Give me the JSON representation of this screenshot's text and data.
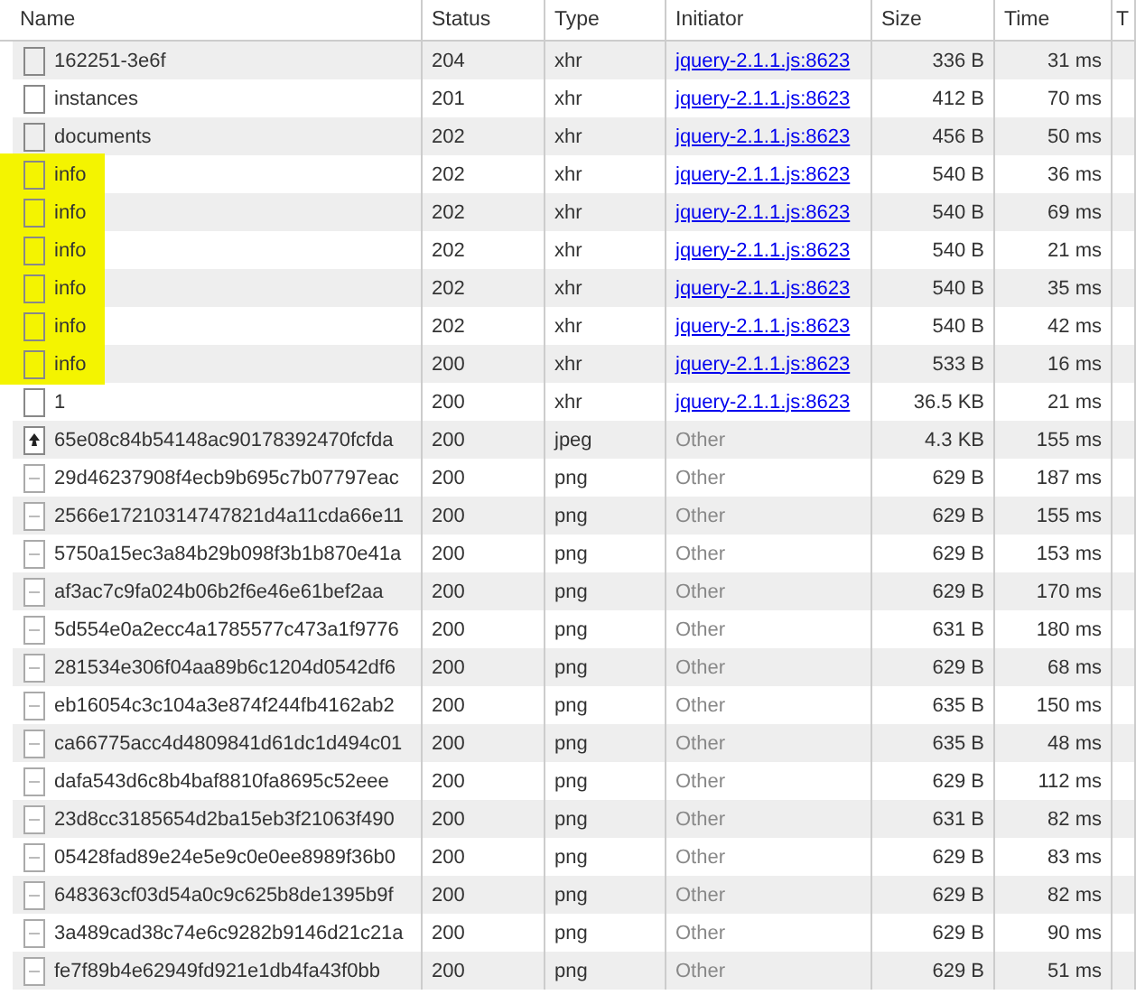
{
  "table": {
    "columns": [
      "Name",
      "Status",
      "Type",
      "Initiator",
      "Size",
      "Time",
      "T"
    ],
    "rows": [
      {
        "name": "162251-3e6f",
        "kind": "document",
        "status": "204",
        "type": "xhr",
        "initiator": {
          "kind": "link",
          "text": "jquery-2.1.1.js:8623"
        },
        "size": "336 B",
        "time": "31 ms",
        "highlighted": false
      },
      {
        "name": "instances",
        "kind": "document",
        "status": "201",
        "type": "xhr",
        "initiator": {
          "kind": "link",
          "text": "jquery-2.1.1.js:8623"
        },
        "size": "412 B",
        "time": "70 ms",
        "highlighted": false
      },
      {
        "name": "documents",
        "kind": "document",
        "status": "202",
        "type": "xhr",
        "initiator": {
          "kind": "link",
          "text": "jquery-2.1.1.js:8623"
        },
        "size": "456 B",
        "time": "50 ms",
        "highlighted": false
      },
      {
        "name": "info",
        "kind": "document",
        "status": "202",
        "type": "xhr",
        "initiator": {
          "kind": "link",
          "text": "jquery-2.1.1.js:8623"
        },
        "size": "540 B",
        "time": "36 ms",
        "highlighted": true
      },
      {
        "name": "info",
        "kind": "document",
        "status": "202",
        "type": "xhr",
        "initiator": {
          "kind": "link",
          "text": "jquery-2.1.1.js:8623"
        },
        "size": "540 B",
        "time": "69 ms",
        "highlighted": true
      },
      {
        "name": "info",
        "kind": "document",
        "status": "202",
        "type": "xhr",
        "initiator": {
          "kind": "link",
          "text": "jquery-2.1.1.js:8623"
        },
        "size": "540 B",
        "time": "21 ms",
        "highlighted": true
      },
      {
        "name": "info",
        "kind": "document",
        "status": "202",
        "type": "xhr",
        "initiator": {
          "kind": "link",
          "text": "jquery-2.1.1.js:8623"
        },
        "size": "540 B",
        "time": "35 ms",
        "highlighted": true
      },
      {
        "name": "info",
        "kind": "document",
        "status": "202",
        "type": "xhr",
        "initiator": {
          "kind": "link",
          "text": "jquery-2.1.1.js:8623"
        },
        "size": "540 B",
        "time": "42 ms",
        "highlighted": true
      },
      {
        "name": "info",
        "kind": "document",
        "status": "200",
        "type": "xhr",
        "initiator": {
          "kind": "link",
          "text": "jquery-2.1.1.js:8623"
        },
        "size": "533 B",
        "time": "16 ms",
        "highlighted": true
      },
      {
        "name": "1",
        "kind": "document",
        "status": "200",
        "type": "xhr",
        "initiator": {
          "kind": "link",
          "text": "jquery-2.1.1.js:8623"
        },
        "size": "36.5 KB",
        "time": "21 ms",
        "highlighted": false
      },
      {
        "name": "65e08c84b54148ac90178392470fcfda",
        "kind": "image",
        "status": "200",
        "type": "jpeg",
        "initiator": {
          "kind": "plain",
          "text": "Other"
        },
        "size": "4.3 KB",
        "time": "155 ms",
        "highlighted": false
      },
      {
        "name": "29d46237908f4ecb9b695c7b07797eac",
        "kind": "blank-image",
        "status": "200",
        "type": "png",
        "initiator": {
          "kind": "plain",
          "text": "Other"
        },
        "size": "629 B",
        "time": "187 ms",
        "highlighted": false
      },
      {
        "name": "2566e17210314747821d4a11cda66e11",
        "kind": "blank-image",
        "status": "200",
        "type": "png",
        "initiator": {
          "kind": "plain",
          "text": "Other"
        },
        "size": "629 B",
        "time": "155 ms",
        "highlighted": false
      },
      {
        "name": "5750a15ec3a84b29b098f3b1b870e41a",
        "kind": "blank-image",
        "status": "200",
        "type": "png",
        "initiator": {
          "kind": "plain",
          "text": "Other"
        },
        "size": "629 B",
        "time": "153 ms",
        "highlighted": false
      },
      {
        "name": "af3ac7c9fa024b06b2f6e46e61bef2aa",
        "kind": "blank-image",
        "status": "200",
        "type": "png",
        "initiator": {
          "kind": "plain",
          "text": "Other"
        },
        "size": "629 B",
        "time": "170 ms",
        "highlighted": false
      },
      {
        "name": "5d554e0a2ecc4a1785577c473a1f9776",
        "kind": "blank-image",
        "status": "200",
        "type": "png",
        "initiator": {
          "kind": "plain",
          "text": "Other"
        },
        "size": "631 B",
        "time": "180 ms",
        "highlighted": false
      },
      {
        "name": "281534e306f04aa89b6c1204d0542df6",
        "kind": "blank-image",
        "status": "200",
        "type": "png",
        "initiator": {
          "kind": "plain",
          "text": "Other"
        },
        "size": "629 B",
        "time": "68 ms",
        "highlighted": false
      },
      {
        "name": "eb16054c3c104a3e874f244fb4162ab2",
        "kind": "blank-image",
        "status": "200",
        "type": "png",
        "initiator": {
          "kind": "plain",
          "text": "Other"
        },
        "size": "635 B",
        "time": "150 ms",
        "highlighted": false
      },
      {
        "name": "ca66775acc4d4809841d61dc1d494c01",
        "kind": "blank-image",
        "status": "200",
        "type": "png",
        "initiator": {
          "kind": "plain",
          "text": "Other"
        },
        "size": "635 B",
        "time": "48 ms",
        "highlighted": false
      },
      {
        "name": "dafa543d6c8b4baf8810fa8695c52eee",
        "kind": "blank-image",
        "status": "200",
        "type": "png",
        "initiator": {
          "kind": "plain",
          "text": "Other"
        },
        "size": "629 B",
        "time": "112 ms",
        "highlighted": false
      },
      {
        "name": "23d8cc3185654d2ba15eb3f21063f490",
        "kind": "blank-image",
        "status": "200",
        "type": "png",
        "initiator": {
          "kind": "plain",
          "text": "Other"
        },
        "size": "631 B",
        "time": "82 ms",
        "highlighted": false
      },
      {
        "name": "05428fad89e24e5e9c0e0ee8989f36b0",
        "kind": "blank-image",
        "status": "200",
        "type": "png",
        "initiator": {
          "kind": "plain",
          "text": "Other"
        },
        "size": "629 B",
        "time": "83 ms",
        "highlighted": false
      },
      {
        "name": "648363cf03d54a0c9c625b8de1395b9f",
        "kind": "blank-image",
        "status": "200",
        "type": "png",
        "initiator": {
          "kind": "plain",
          "text": "Other"
        },
        "size": "629 B",
        "time": "82 ms",
        "highlighted": false
      },
      {
        "name": "3a489cad38c74e6c9282b9146d21c21a",
        "kind": "blank-image",
        "status": "200",
        "type": "png",
        "initiator": {
          "kind": "plain",
          "text": "Other"
        },
        "size": "629 B",
        "time": "90 ms",
        "highlighted": false
      },
      {
        "name": "fe7f89b4e62949fd921e1db4fa43f0bb",
        "kind": "blank-image",
        "status": "200",
        "type": "png",
        "initiator": {
          "kind": "plain",
          "text": "Other"
        },
        "size": "629 B",
        "time": "51 ms",
        "highlighted": false
      }
    ]
  }
}
